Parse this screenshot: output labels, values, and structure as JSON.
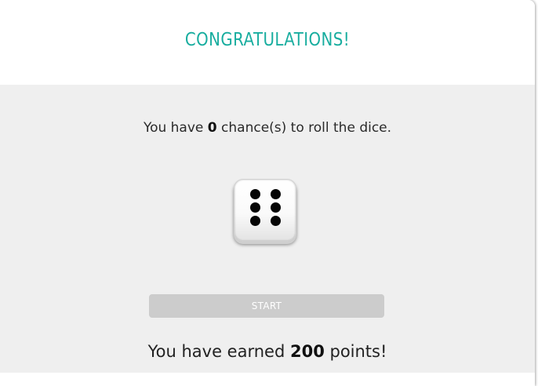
{
  "dialog": {
    "title": "CONGRATULATIONS!",
    "title_color": "#18ad9f"
  },
  "chances": {
    "prefix": "You have ",
    "count": "0",
    "suffix": " chance(s) to roll the dice."
  },
  "dice": {
    "face_value": 6
  },
  "start_button": {
    "label": "START",
    "state": "disabled",
    "color": "#cccccc"
  },
  "earned": {
    "prefix": "You have earned ",
    "points": "200",
    "suffix": " points!"
  },
  "colors": {
    "body_background": "#efefef",
    "header_background": "#ffffff"
  }
}
